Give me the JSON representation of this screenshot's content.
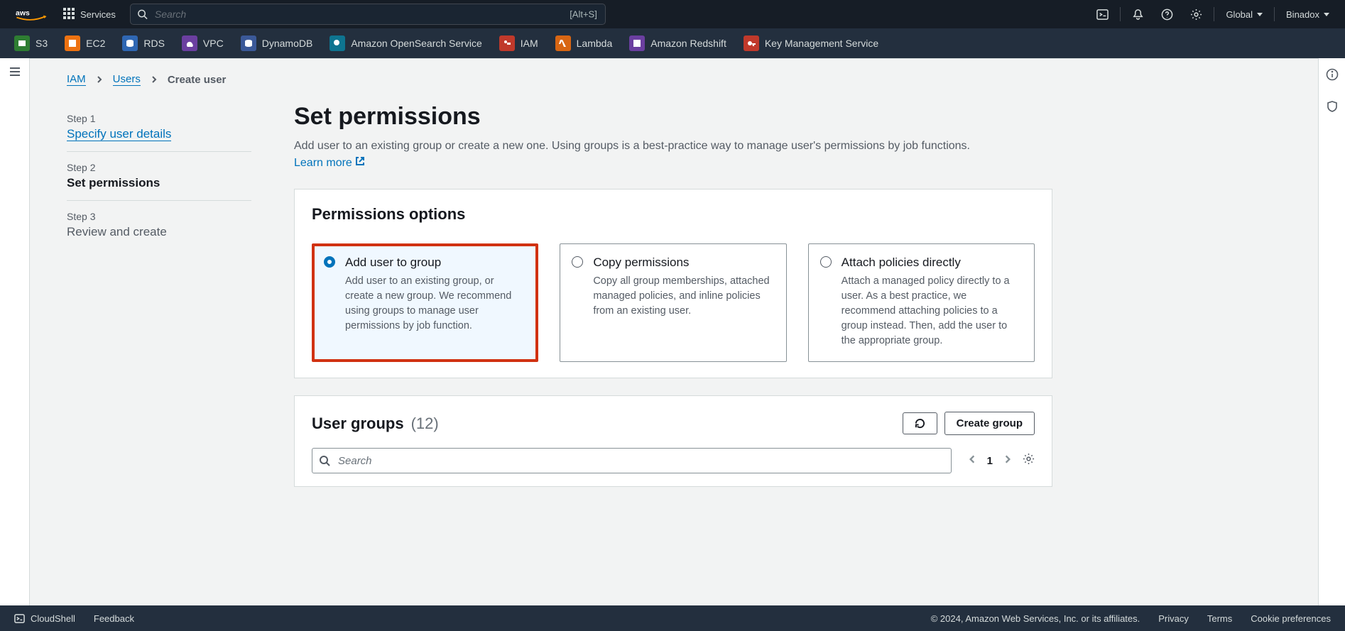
{
  "topnav": {
    "services_label": "Services",
    "search_placeholder": "Search",
    "search_kbd": "[Alt+S]",
    "region": "Global",
    "account": "Binadox"
  },
  "favbar": [
    {
      "label": "S3",
      "color": "green"
    },
    {
      "label": "EC2",
      "color": "orange"
    },
    {
      "label": "RDS",
      "color": "blue"
    },
    {
      "label": "VPC",
      "color": "purple"
    },
    {
      "label": "DynamoDB",
      "color": "navy"
    },
    {
      "label": "Amazon OpenSearch Service",
      "color": "teal"
    },
    {
      "label": "IAM",
      "color": "red"
    },
    {
      "label": "Lambda",
      "color": "lambda"
    },
    {
      "label": "Amazon Redshift",
      "color": "redshift"
    },
    {
      "label": "Key Management Service",
      "color": "red"
    }
  ],
  "breadcrumb": {
    "root": "IAM",
    "mid": "Users",
    "current": "Create user"
  },
  "steps": [
    {
      "lbl": "Step 1",
      "title": "Specify user details",
      "link": true
    },
    {
      "lbl": "Step 2",
      "title": "Set permissions",
      "active": true
    },
    {
      "lbl": "Step 3",
      "title": "Review and create"
    }
  ],
  "page": {
    "title": "Set permissions",
    "subtitle_a": "Add user to an existing group or create a new one. Using groups is a best-practice way to manage user's permissions by job functions. ",
    "learn_more": "Learn more"
  },
  "perm_options_title": "Permissions options",
  "options": [
    {
      "title": "Add user to group",
      "desc": "Add user to an existing group, or create a new group. We recommend using groups to manage user permissions by job function.",
      "selected": true
    },
    {
      "title": "Copy permissions",
      "desc": "Copy all group memberships, attached managed policies, and inline policies from an existing user."
    },
    {
      "title": "Attach policies directly",
      "desc": "Attach a managed policy directly to a user. As a best practice, we recommend attaching policies to a group instead. Then, add the user to the appropriate group."
    }
  ],
  "user_groups": {
    "title": "User groups",
    "count": "(12)",
    "create_btn": "Create group",
    "search_placeholder": "Search",
    "page_num": "1"
  },
  "footer": {
    "cloudshell": "CloudShell",
    "feedback": "Feedback",
    "copyright": "© 2024, Amazon Web Services, Inc. or its affiliates.",
    "privacy": "Privacy",
    "terms": "Terms",
    "cookies": "Cookie preferences"
  }
}
